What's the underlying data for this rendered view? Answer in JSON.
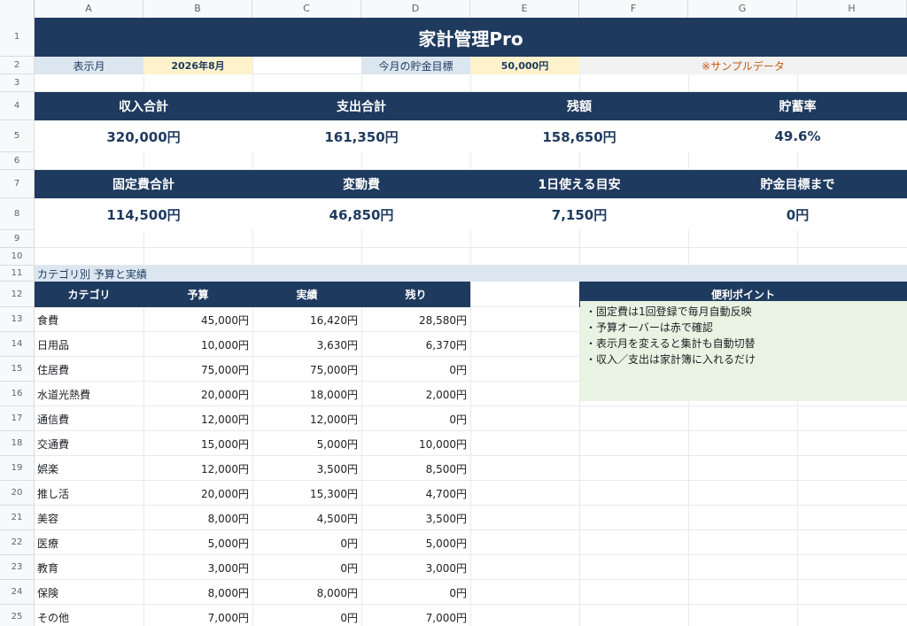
{
  "columns": [
    "A",
    "B",
    "C",
    "D",
    "E",
    "F",
    "G",
    "H"
  ],
  "rows": [
    "1",
    "2",
    "3",
    "4",
    "5",
    "6",
    "7",
    "8",
    "9",
    "10",
    "11",
    "12",
    "13",
    "14",
    "15",
    "16",
    "17",
    "18",
    "19",
    "20",
    "21",
    "22",
    "23",
    "24",
    "25"
  ],
  "title": "家計管理Pro",
  "month_label": "表示月",
  "month_value": "2026年8月",
  "goal_label": "今月の貯金目標",
  "goal_value": "50,000円",
  "sample_note": "※サンプルデータ",
  "kpi_row1": [
    {
      "label": "収入合計",
      "value": "320,000円"
    },
    {
      "label": "支出合計",
      "value": "161,350円"
    },
    {
      "label": "残額",
      "value": "158,650円"
    },
    {
      "label": "貯蓄率",
      "value": "49.6%"
    }
  ],
  "kpi_row2": [
    {
      "label": "固定費合計",
      "value": "114,500円"
    },
    {
      "label": "変動費",
      "value": "46,850円"
    },
    {
      "label": "1日使える目安",
      "value": "7,150円"
    },
    {
      "label": "貯金目標まで",
      "value": "0円"
    }
  ],
  "section_title": "カテゴリ別 予算と実績",
  "table": {
    "headers": [
      "カテゴリ",
      "予算",
      "実績",
      "残り"
    ],
    "rows": [
      [
        "食費",
        "45,000円",
        "16,420円",
        "28,580円"
      ],
      [
        "日用品",
        "10,000円",
        "3,630円",
        "6,370円"
      ],
      [
        "住居費",
        "75,000円",
        "75,000円",
        "0円"
      ],
      [
        "水道光熱費",
        "20,000円",
        "18,000円",
        "2,000円"
      ],
      [
        "通信費",
        "12,000円",
        "12,000円",
        "0円"
      ],
      [
        "交通費",
        "15,000円",
        "5,000円",
        "10,000円"
      ],
      [
        "娯楽",
        "12,000円",
        "3,500円",
        "8,500円"
      ],
      [
        "推し活",
        "20,000円",
        "15,300円",
        "4,700円"
      ],
      [
        "美容",
        "8,000円",
        "4,500円",
        "3,500円"
      ],
      [
        "医療",
        "5,000円",
        "0円",
        "5,000円"
      ],
      [
        "教育",
        "3,000円",
        "0円",
        "3,000円"
      ],
      [
        "保険",
        "8,000円",
        "8,000円",
        "0円"
      ],
      [
        "その他",
        "7,000円",
        "0円",
        "7,000円"
      ]
    ]
  },
  "tips_title": "便利ポイント",
  "tips": [
    "・固定費は1回登録で毎月自動反映",
    "・予算オーバーは赤で確認",
    "・表示月を変えると集計も自動切替",
    "・収入／支出は家計簿に入れるだけ"
  ],
  "colors": {
    "navy": "#1f3a5f",
    "label_blue": "#dce6f0",
    "value_yellow": "#fdf2cc",
    "note_orange": "#c55a11",
    "tips_green": "#e9f3e3"
  }
}
